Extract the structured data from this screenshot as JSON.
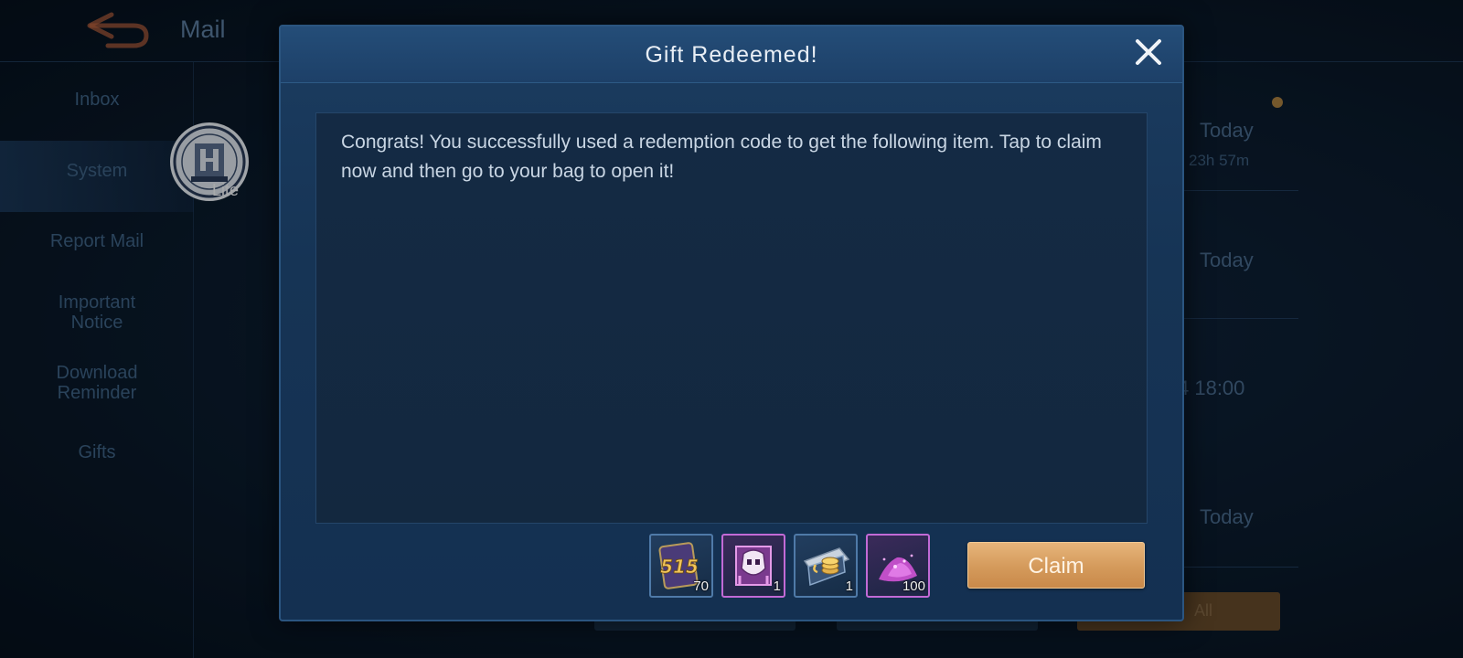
{
  "background": {
    "title": "Mail",
    "sidebar": [
      {
        "label": "Inbox"
      },
      {
        "label": "System"
      },
      {
        "label": "Report Mail"
      },
      {
        "label": "Important Notice"
      },
      {
        "label": "Download Reminder"
      },
      {
        "label": "Gifts"
      }
    ],
    "avatar_text": "Lite",
    "right_column": {
      "row1_date": "Today",
      "row1_time": "23h 57m",
      "row2_date": "Today",
      "row3_date": "4 18:00",
      "row4_date": "Today",
      "button_partial": "All"
    }
  },
  "modal": {
    "title": "Gift Redeemed!",
    "message": "Congrats! You successfully used a redemption code to get the following item. Tap to claim now and then go to your bag to open it!",
    "items": [
      {
        "icon": "515-ticket-icon",
        "count": "70"
      },
      {
        "icon": "skin-box-icon",
        "count": "1"
      },
      {
        "icon": "coin-voucher-icon",
        "count": "1"
      },
      {
        "icon": "magic-dust-icon",
        "count": "100"
      }
    ],
    "claim_label": "Claim"
  },
  "colors": {
    "modal_bg": "#163455",
    "claim_button": "#d49a5b",
    "rare_border": "#c26ad6"
  }
}
